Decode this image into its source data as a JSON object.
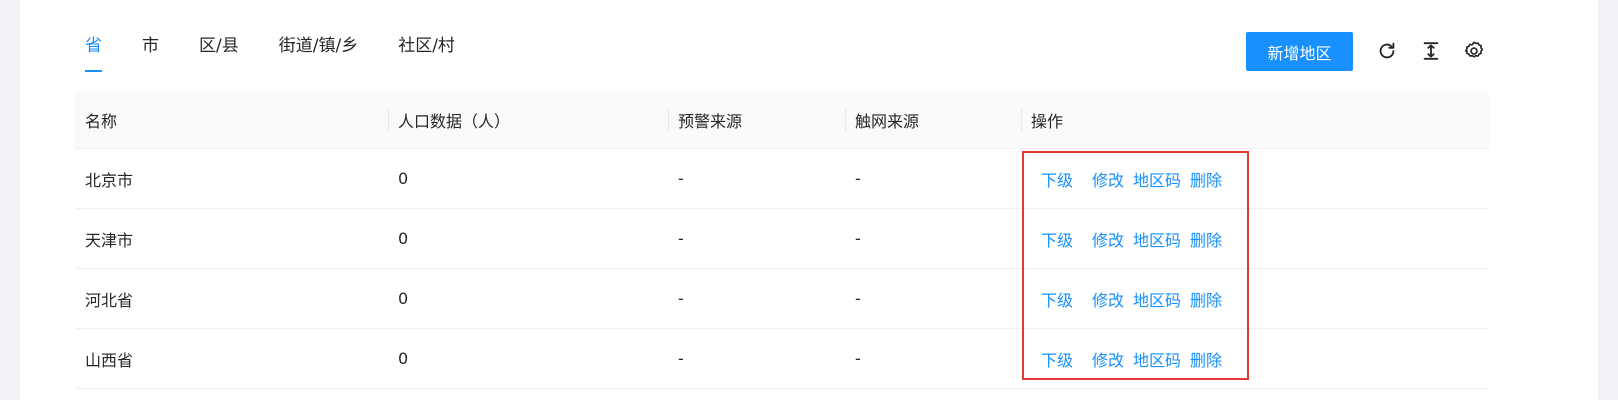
{
  "tabs": [
    {
      "label": "省",
      "active": true
    },
    {
      "label": "市",
      "active": false
    },
    {
      "label": "区/县",
      "active": false
    },
    {
      "label": "街道/镇/乡",
      "active": false
    },
    {
      "label": "社区/村",
      "active": false
    }
  ],
  "toolbar": {
    "add_label": "新增地区",
    "icons": [
      "refresh-icon",
      "column-height-icon",
      "settings-icon"
    ]
  },
  "table": {
    "columns": [
      "名称",
      "人口数据（人）",
      "预警来源",
      "触网来源",
      "操作"
    ],
    "rows": [
      {
        "name": "北京市",
        "population": "0",
        "warning_source": "-",
        "net_source": "-"
      },
      {
        "name": "天津市",
        "population": "0",
        "warning_source": "-",
        "net_source": "-"
      },
      {
        "name": "河北省",
        "population": "0",
        "warning_source": "-",
        "net_source": "-"
      },
      {
        "name": "山西省",
        "population": "0",
        "warning_source": "-",
        "net_source": "-"
      }
    ],
    "actions": {
      "sub": "下级",
      "edit": "修改",
      "code": "地区码",
      "delete": "删除"
    }
  },
  "colors": {
    "accent": "#1890ff",
    "highlight_border": "#e53935",
    "header_bg": "#fafafa",
    "page_bg": "#f0f2f5"
  }
}
